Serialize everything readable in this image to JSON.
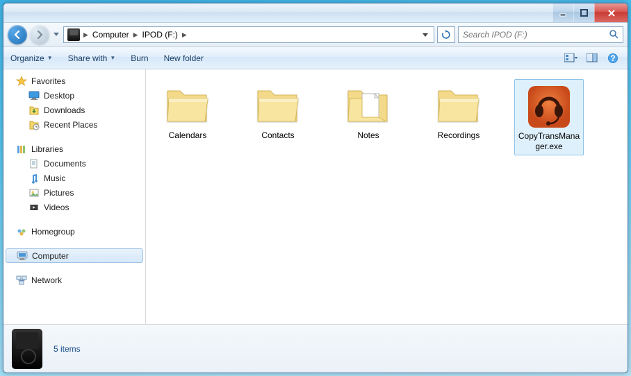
{
  "breadcrumb": {
    "seg1": "Computer",
    "seg2": "IPOD (F:)"
  },
  "search": {
    "placeholder": "Search IPOD (F:)"
  },
  "toolbar": {
    "organize": "Organize",
    "share": "Share with",
    "burn": "Burn",
    "newfolder": "New folder"
  },
  "sidebar": {
    "favorites": "Favorites",
    "desktop": "Desktop",
    "downloads": "Downloads",
    "recent": "Recent Places",
    "libraries": "Libraries",
    "documents": "Documents",
    "music": "Music",
    "pictures": "Pictures",
    "videos": "Videos",
    "homegroup": "Homegroup",
    "computer": "Computer",
    "network": "Network"
  },
  "files": {
    "f0": "Calendars",
    "f1": "Contacts",
    "f2": "Notes",
    "f3": "Recordings",
    "f4": "CopyTransManager.exe"
  },
  "status": {
    "count": "5 items"
  }
}
